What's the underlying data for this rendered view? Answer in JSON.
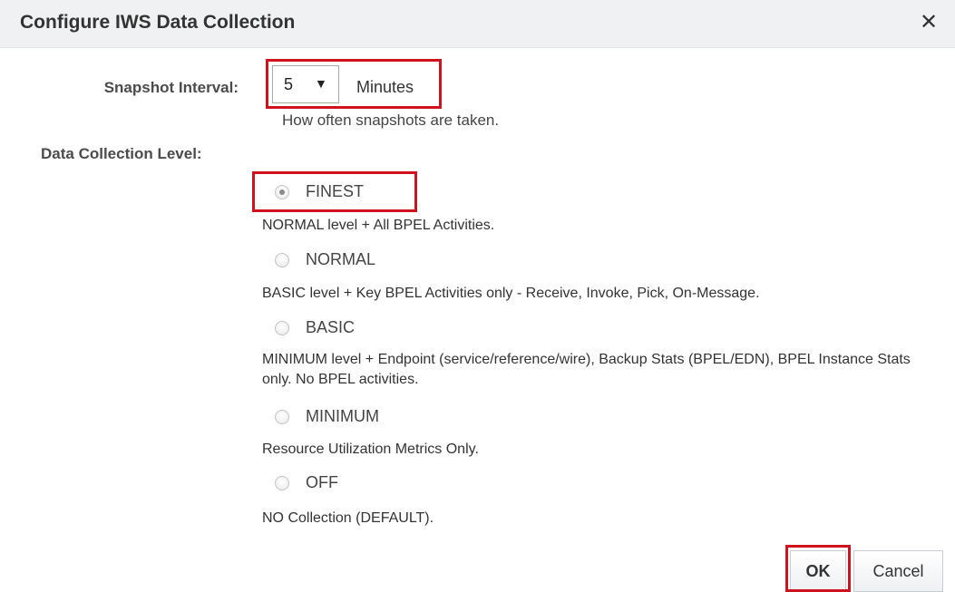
{
  "dialog": {
    "title": "Configure IWS Data Collection",
    "close_icon": "close-icon",
    "close_glyph": "✕"
  },
  "snapshot": {
    "label": "Snapshot Interval:",
    "selected_value": "5",
    "arrow_glyph": "▼",
    "unit": "Minutes",
    "help": "How often snapshots are taken."
  },
  "level": {
    "label": "Data Collection Level:",
    "selected": "FINEST",
    "options": [
      {
        "label": "FINEST",
        "desc": "NORMAL level + All BPEL Activities."
      },
      {
        "label": "NORMAL",
        "desc": "BASIC level + Key BPEL Activities only - Receive, Invoke, Pick, On-Message."
      },
      {
        "label": "BASIC",
        "desc": "MINIMUM level + Endpoint (service/reference/wire), Backup Stats (BPEL/EDN), BPEL Instance Stats only. No BPEL activities."
      },
      {
        "label": "MINIMUM",
        "desc": "Resource Utilization Metrics Only."
      },
      {
        "label": "OFF",
        "desc": "NO Collection (DEFAULT)."
      }
    ]
  },
  "buttons": {
    "ok": "OK",
    "cancel": "Cancel"
  },
  "colors": {
    "highlight": "#d0121e",
    "titlebar": "#f0f1f2"
  }
}
